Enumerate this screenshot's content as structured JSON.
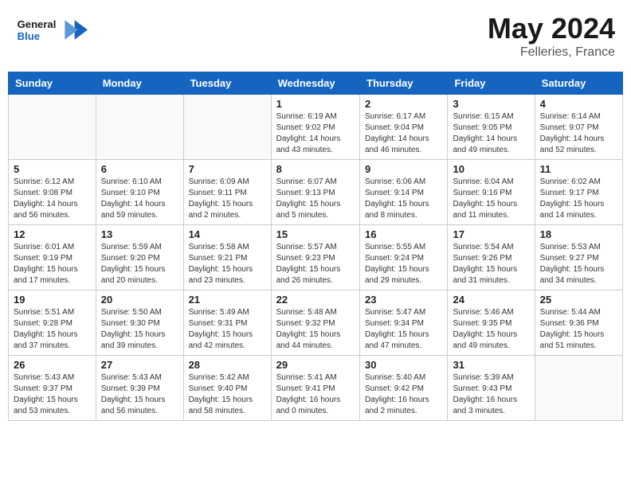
{
  "header": {
    "logo_general": "General",
    "logo_blue": "Blue",
    "title": "May 2024",
    "location": "Felleries, France"
  },
  "days_of_week": [
    "Sunday",
    "Monday",
    "Tuesday",
    "Wednesday",
    "Thursday",
    "Friday",
    "Saturday"
  ],
  "weeks": [
    [
      {
        "day": "",
        "info": ""
      },
      {
        "day": "",
        "info": ""
      },
      {
        "day": "",
        "info": ""
      },
      {
        "day": "1",
        "info": "Sunrise: 6:19 AM\nSunset: 9:02 PM\nDaylight: 14 hours\nand 43 minutes."
      },
      {
        "day": "2",
        "info": "Sunrise: 6:17 AM\nSunset: 9:04 PM\nDaylight: 14 hours\nand 46 minutes."
      },
      {
        "day": "3",
        "info": "Sunrise: 6:15 AM\nSunset: 9:05 PM\nDaylight: 14 hours\nand 49 minutes."
      },
      {
        "day": "4",
        "info": "Sunrise: 6:14 AM\nSunset: 9:07 PM\nDaylight: 14 hours\nand 52 minutes."
      }
    ],
    [
      {
        "day": "5",
        "info": "Sunrise: 6:12 AM\nSunset: 9:08 PM\nDaylight: 14 hours\nand 56 minutes."
      },
      {
        "day": "6",
        "info": "Sunrise: 6:10 AM\nSunset: 9:10 PM\nDaylight: 14 hours\nand 59 minutes."
      },
      {
        "day": "7",
        "info": "Sunrise: 6:09 AM\nSunset: 9:11 PM\nDaylight: 15 hours\nand 2 minutes."
      },
      {
        "day": "8",
        "info": "Sunrise: 6:07 AM\nSunset: 9:13 PM\nDaylight: 15 hours\nand 5 minutes."
      },
      {
        "day": "9",
        "info": "Sunrise: 6:06 AM\nSunset: 9:14 PM\nDaylight: 15 hours\nand 8 minutes."
      },
      {
        "day": "10",
        "info": "Sunrise: 6:04 AM\nSunset: 9:16 PM\nDaylight: 15 hours\nand 11 minutes."
      },
      {
        "day": "11",
        "info": "Sunrise: 6:02 AM\nSunset: 9:17 PM\nDaylight: 15 hours\nand 14 minutes."
      }
    ],
    [
      {
        "day": "12",
        "info": "Sunrise: 6:01 AM\nSunset: 9:19 PM\nDaylight: 15 hours\nand 17 minutes."
      },
      {
        "day": "13",
        "info": "Sunrise: 5:59 AM\nSunset: 9:20 PM\nDaylight: 15 hours\nand 20 minutes."
      },
      {
        "day": "14",
        "info": "Sunrise: 5:58 AM\nSunset: 9:21 PM\nDaylight: 15 hours\nand 23 minutes."
      },
      {
        "day": "15",
        "info": "Sunrise: 5:57 AM\nSunset: 9:23 PM\nDaylight: 15 hours\nand 26 minutes."
      },
      {
        "day": "16",
        "info": "Sunrise: 5:55 AM\nSunset: 9:24 PM\nDaylight: 15 hours\nand 29 minutes."
      },
      {
        "day": "17",
        "info": "Sunrise: 5:54 AM\nSunset: 9:26 PM\nDaylight: 15 hours\nand 31 minutes."
      },
      {
        "day": "18",
        "info": "Sunrise: 5:53 AM\nSunset: 9:27 PM\nDaylight: 15 hours\nand 34 minutes."
      }
    ],
    [
      {
        "day": "19",
        "info": "Sunrise: 5:51 AM\nSunset: 9:28 PM\nDaylight: 15 hours\nand 37 minutes."
      },
      {
        "day": "20",
        "info": "Sunrise: 5:50 AM\nSunset: 9:30 PM\nDaylight: 15 hours\nand 39 minutes."
      },
      {
        "day": "21",
        "info": "Sunrise: 5:49 AM\nSunset: 9:31 PM\nDaylight: 15 hours\nand 42 minutes."
      },
      {
        "day": "22",
        "info": "Sunrise: 5:48 AM\nSunset: 9:32 PM\nDaylight: 15 hours\nand 44 minutes."
      },
      {
        "day": "23",
        "info": "Sunrise: 5:47 AM\nSunset: 9:34 PM\nDaylight: 15 hours\nand 47 minutes."
      },
      {
        "day": "24",
        "info": "Sunrise: 5:46 AM\nSunset: 9:35 PM\nDaylight: 15 hours\nand 49 minutes."
      },
      {
        "day": "25",
        "info": "Sunrise: 5:44 AM\nSunset: 9:36 PM\nDaylight: 15 hours\nand 51 minutes."
      }
    ],
    [
      {
        "day": "26",
        "info": "Sunrise: 5:43 AM\nSunset: 9:37 PM\nDaylight: 15 hours\nand 53 minutes."
      },
      {
        "day": "27",
        "info": "Sunrise: 5:43 AM\nSunset: 9:39 PM\nDaylight: 15 hours\nand 56 minutes."
      },
      {
        "day": "28",
        "info": "Sunrise: 5:42 AM\nSunset: 9:40 PM\nDaylight: 15 hours\nand 58 minutes."
      },
      {
        "day": "29",
        "info": "Sunrise: 5:41 AM\nSunset: 9:41 PM\nDaylight: 16 hours\nand 0 minutes."
      },
      {
        "day": "30",
        "info": "Sunrise: 5:40 AM\nSunset: 9:42 PM\nDaylight: 16 hours\nand 2 minutes."
      },
      {
        "day": "31",
        "info": "Sunrise: 5:39 AM\nSunset: 9:43 PM\nDaylight: 16 hours\nand 3 minutes."
      },
      {
        "day": "",
        "info": ""
      }
    ]
  ]
}
